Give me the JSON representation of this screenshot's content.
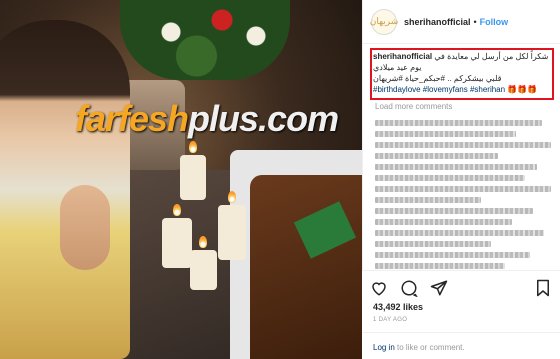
{
  "watermark": {
    "part1": "farfesh",
    "part2": "plus.com"
  },
  "post": {
    "username": "sherihanofficial",
    "separator": "•",
    "follow_label": "Follow",
    "avatar_text": "شريهان",
    "caption_user": "sherihanofficial",
    "caption_line1": "شكراً لكل من أرسل لي معايدة في",
    "caption_line2": "يوم عيد ميلادي",
    "caption_line3": "قلبي بيشكركم .. #حبكم_حياة #شريهان",
    "caption_tags": "#birthdaylove #lovemyfans #sherihan 🎁🎁🎁",
    "load_more": "Load more comments",
    "likes": "43,492 likes",
    "date": "1 DAY AGO",
    "login_text_link": "Log in",
    "login_text_rest": " to like or comment."
  },
  "colors": {
    "accent": "#3897f0",
    "highlight_box": "#e0141e",
    "link": "#003569"
  },
  "icons": [
    "heart-icon",
    "comment-icon",
    "share-icon",
    "bookmark-icon"
  ]
}
